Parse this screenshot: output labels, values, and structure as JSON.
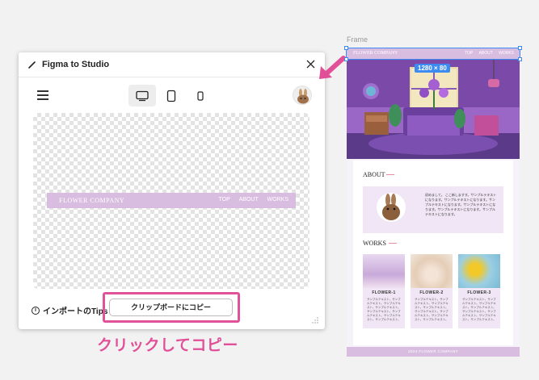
{
  "plugin": {
    "title": "Figma to Studio",
    "device_tabs": [
      "desktop",
      "tablet",
      "mobile"
    ],
    "active_device": "desktop",
    "tips_label": "インポートのTips",
    "copy_button": "クリップボードにコピー"
  },
  "preview": {
    "logo": "FLOWER COMPANY",
    "nav": [
      "TOP",
      "ABOUT",
      "WORKS"
    ]
  },
  "annotation": {
    "caption": "クリックしてコピー",
    "accent_color": "#e04f97"
  },
  "frame": {
    "label": "Frame",
    "size_badge": "1280 × 80",
    "logo": "FLOWER COMPANY",
    "nav": [
      "TOP",
      "ABOUT",
      "WORKS"
    ],
    "about_title": "ABOUT",
    "about_text": "初めまして。\nここ新しますす。サンプルテキストになります。サンプルテキストになります。サンプルテキストになります。サンプルテキストになります。サンプルテキストになります。サンプルテキストになります。",
    "works_title": "WORKS",
    "works": [
      {
        "name": "FLOWER-1",
        "text": "サンプルテキスト。サンプルテキスト。サンプルテキスト。サンプルテキスト。サンプルテキスト。サンプルテキスト。サンプルテキスト。サンプルテキスト。"
      },
      {
        "name": "FLOWER-2",
        "text": "サンプルテキスト。サンプルテキスト。サンプルテキスト。サンプルテキスト。サンプルテキスト。サンプルテキスト。サンプルテキスト。サンプルテキスト。"
      },
      {
        "name": "FLOWER-3",
        "text": "サンプルテキスト。サンプルテキスト。サンプルテキスト。サンプルテキスト。サンプルテキスト。サンプルテキスト。サンプルテキスト。サンプルテキスト。"
      }
    ],
    "footer": "2024 FLOWER COMPANY",
    "brand_color": "#d9bde0",
    "selection_color": "#3b8bf0"
  }
}
